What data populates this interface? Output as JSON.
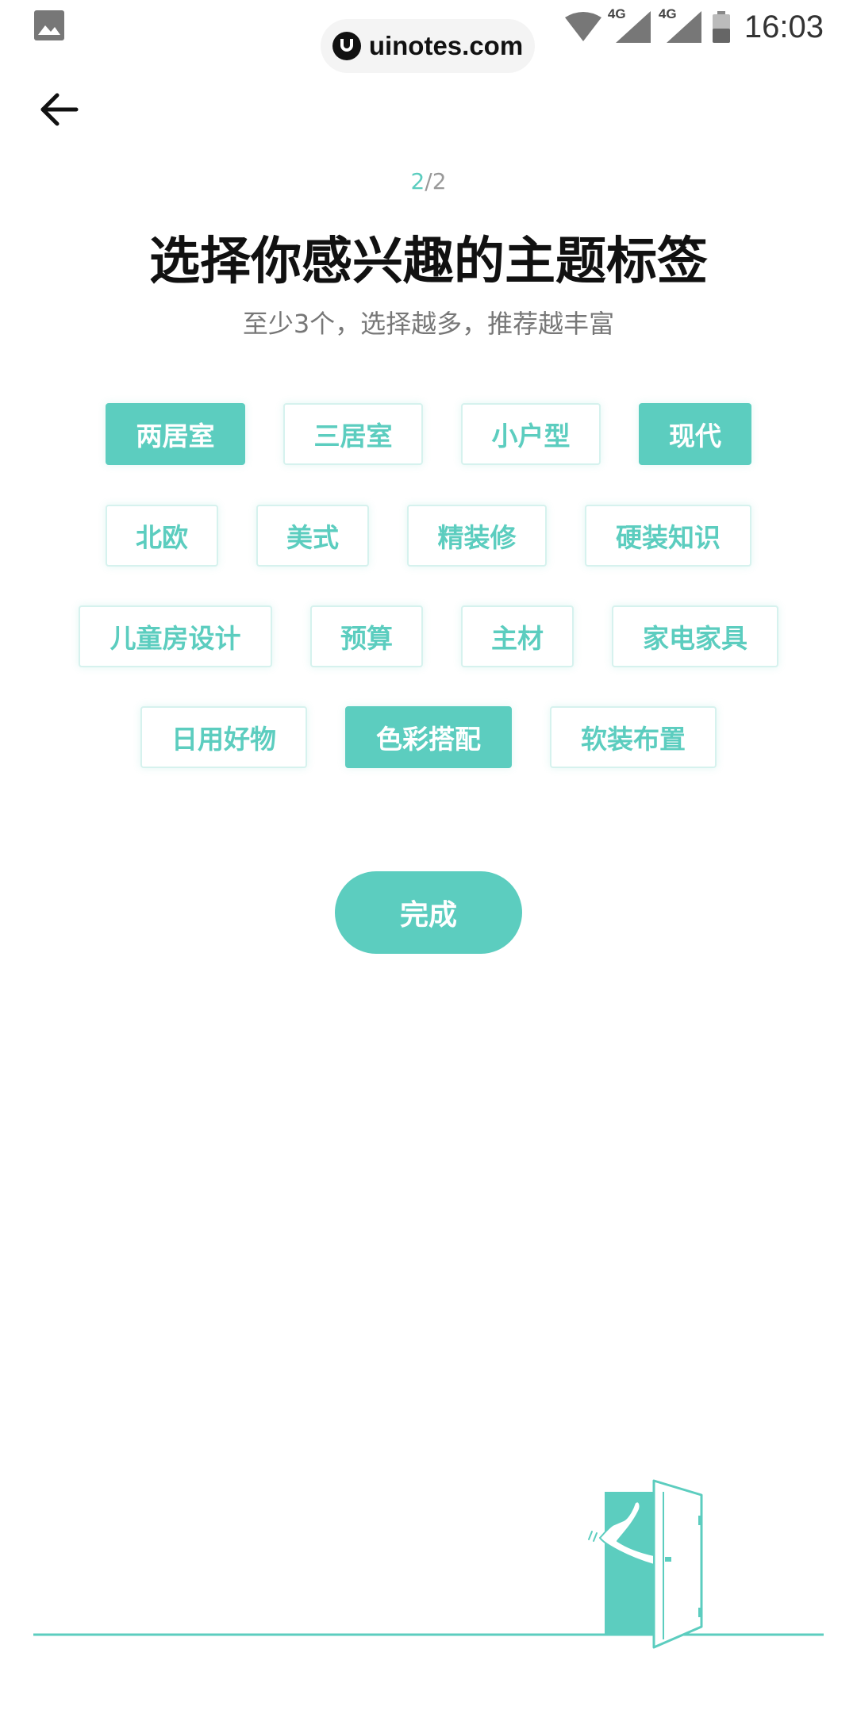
{
  "status_bar": {
    "time": "16:03",
    "network_1": "4G",
    "network_2": "4G"
  },
  "watermark": {
    "text": "uinotes.com"
  },
  "header": {
    "back_icon": "arrow-left-icon"
  },
  "progress": {
    "current": "2",
    "separator": "/",
    "total": "2"
  },
  "title": "选择你感兴趣的主题标签",
  "subtitle": "至少3个，选择越多，推荐越丰富",
  "tag_rows": [
    [
      {
        "label": "两居室",
        "selected": true
      },
      {
        "label": "三居室",
        "selected": false
      },
      {
        "label": "小户型",
        "selected": false
      },
      {
        "label": "现代",
        "selected": true
      }
    ],
    [
      {
        "label": "北欧",
        "selected": false
      },
      {
        "label": "美式",
        "selected": false
      },
      {
        "label": "精装修",
        "selected": false
      },
      {
        "label": "硬装知识",
        "selected": false
      }
    ],
    [
      {
        "label": "儿童房设计",
        "selected": false
      },
      {
        "label": "预算",
        "selected": false
      },
      {
        "label": "主材",
        "selected": false
      },
      {
        "label": "家电家具",
        "selected": false
      }
    ],
    [
      {
        "label": "日用好物",
        "selected": false
      },
      {
        "label": "色彩搭配",
        "selected": true
      },
      {
        "label": "软装布置",
        "selected": false
      }
    ]
  ],
  "done_button": {
    "label": "完成"
  },
  "colors": {
    "accent": "#5ccdbf",
    "tag_border": "#d6f2ee",
    "title": "#111111",
    "subtitle": "#777777"
  }
}
